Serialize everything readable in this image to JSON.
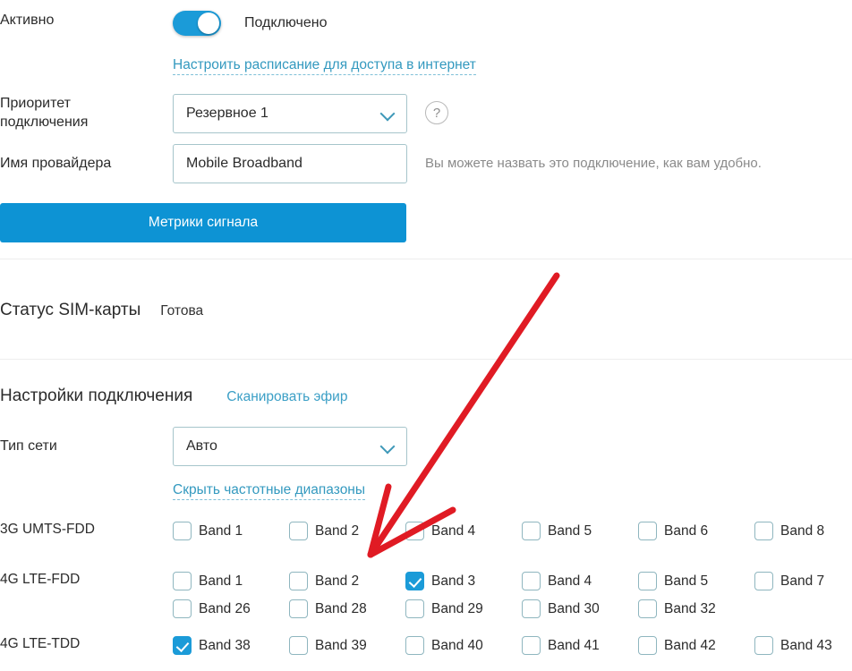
{
  "active_row": {
    "label": "Активно",
    "toggle_state_label": "Подключено",
    "toggle_on": true,
    "toggle_color": "#1b9bd8"
  },
  "schedule_link": {
    "label": "Настроить расписание для доступа в интернет"
  },
  "priority_row": {
    "label_line1": "Приоритет",
    "label_line2": "подключения",
    "value": "Резервное 1",
    "help_icon": "?"
  },
  "provider_row": {
    "label": "Имя провайдера",
    "value": "Mobile Broadband",
    "hint": "Вы можете назвать это подключение, как вам удобно."
  },
  "signal_button": {
    "label": "Метрики сигнала",
    "color": "#0d93d4"
  },
  "sim_status": {
    "label": "Статус SIM-карты",
    "value": "Готова"
  },
  "connection_settings": {
    "title": "Настройки подключения",
    "scan_link": "Сканировать эфир",
    "network_type_label": "Тип сети",
    "network_type_value": "Авто",
    "toggle_bands_link": "Скрыть частотные диапазоны"
  },
  "band_groups": [
    {
      "label": "3G UMTS-FDD",
      "rows": [
        [
          {
            "label": "Band 1",
            "checked": false
          },
          {
            "label": "Band 2",
            "checked": false
          },
          {
            "label": "Band 4",
            "checked": false
          },
          {
            "label": "Band 5",
            "checked": false
          },
          {
            "label": "Band 6",
            "checked": false
          },
          {
            "label": "Band 8",
            "checked": false
          }
        ]
      ]
    },
    {
      "label": "4G LTE-FDD",
      "rows": [
        [
          {
            "label": "Band 1",
            "checked": false
          },
          {
            "label": "Band 2",
            "checked": false
          },
          {
            "label": "Band 3",
            "checked": true
          },
          {
            "label": "Band 4",
            "checked": false
          },
          {
            "label": "Band 5",
            "checked": false
          },
          {
            "label": "Band 7",
            "checked": false
          }
        ],
        [
          {
            "label": "Band 26",
            "checked": false
          },
          {
            "label": "Band 28",
            "checked": false
          },
          {
            "label": "Band 29",
            "checked": false
          },
          {
            "label": "Band 30",
            "checked": false
          },
          {
            "label": "Band 32",
            "checked": false
          }
        ]
      ]
    },
    {
      "label": "4G LTE-TDD",
      "rows": [
        [
          {
            "label": "Band 38",
            "checked": true
          },
          {
            "label": "Band 39",
            "checked": false
          },
          {
            "label": "Band 40",
            "checked": false
          },
          {
            "label": "Band 41",
            "checked": false
          },
          {
            "label": "Band 42",
            "checked": false
          },
          {
            "label": "Band 43",
            "checked": false
          }
        ]
      ]
    }
  ],
  "annotation": {
    "color": "#e01b24",
    "shape": "arrow-pointing-down-left"
  }
}
